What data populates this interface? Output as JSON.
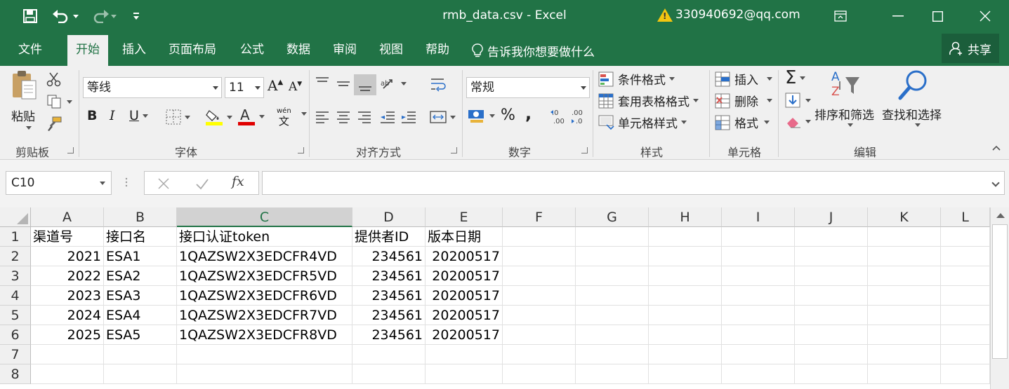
{
  "window": {
    "title": "rmb_data.csv  -  Excel",
    "account": "330940692@qq.com"
  },
  "tabs": [
    "文件",
    "开始",
    "插入",
    "页面布局",
    "公式",
    "数据",
    "审阅",
    "视图",
    "帮助"
  ],
  "tell_me": "告诉我你想要做什么",
  "share": "共享",
  "ribbon": {
    "clipboard": {
      "paste": "粘贴",
      "label": "剪贴板"
    },
    "font": {
      "name": "等线",
      "size": "11",
      "bold": "B",
      "italic": "I",
      "underline": "U",
      "phonetic_top": "wén",
      "phonetic_bottom": "文",
      "label": "字体",
      "grow": "A",
      "shrink": "A"
    },
    "alignment": {
      "label": "对齐方式"
    },
    "number": {
      "format": "常规",
      "percent": "%",
      "comma": ",",
      "label": "数字"
    },
    "styles": {
      "conditional": "条件格式",
      "table": "套用表格格式",
      "cell": "单元格样式",
      "label": "样式"
    },
    "cells": {
      "insert": "插入",
      "delete": "删除",
      "format": "格式",
      "label": "单元格"
    },
    "editing": {
      "sort": "排序和筛选",
      "find": "查找和选择",
      "label": "编辑",
      "sigma": "Σ"
    }
  },
  "formula_bar": {
    "name_box": "C10",
    "fx": "fx",
    "value": ""
  },
  "colors": {
    "accent": "#217346"
  },
  "grid": {
    "columns": [
      "A",
      "B",
      "C",
      "D",
      "E",
      "F",
      "G",
      "H",
      "I",
      "J",
      "K",
      "L"
    ],
    "selected_column": "C",
    "row_numbers": [
      "1",
      "2",
      "3",
      "4",
      "5",
      "6",
      "7",
      "8"
    ],
    "rows": [
      [
        "渠道号",
        "接口名",
        "接口认证token",
        "提供者ID",
        "版本日期"
      ],
      [
        "2021",
        "ESA1",
        "1QAZSW2X3EDCFR4VD",
        "234561",
        "20200517"
      ],
      [
        "2022",
        "ESA2",
        "1QAZSW2X3EDCFR5VD",
        "234561",
        "20200517"
      ],
      [
        "2023",
        "ESA3",
        "1QAZSW2X3EDCFR6VD",
        "234561",
        "20200517"
      ],
      [
        "2024",
        "ESA4",
        "1QAZSW2X3EDCFR7VD",
        "234561",
        "20200517"
      ],
      [
        "2025",
        "ESA5",
        "1QAZSW2X3EDCFR8VD",
        "234561",
        "20200517"
      ]
    ]
  }
}
